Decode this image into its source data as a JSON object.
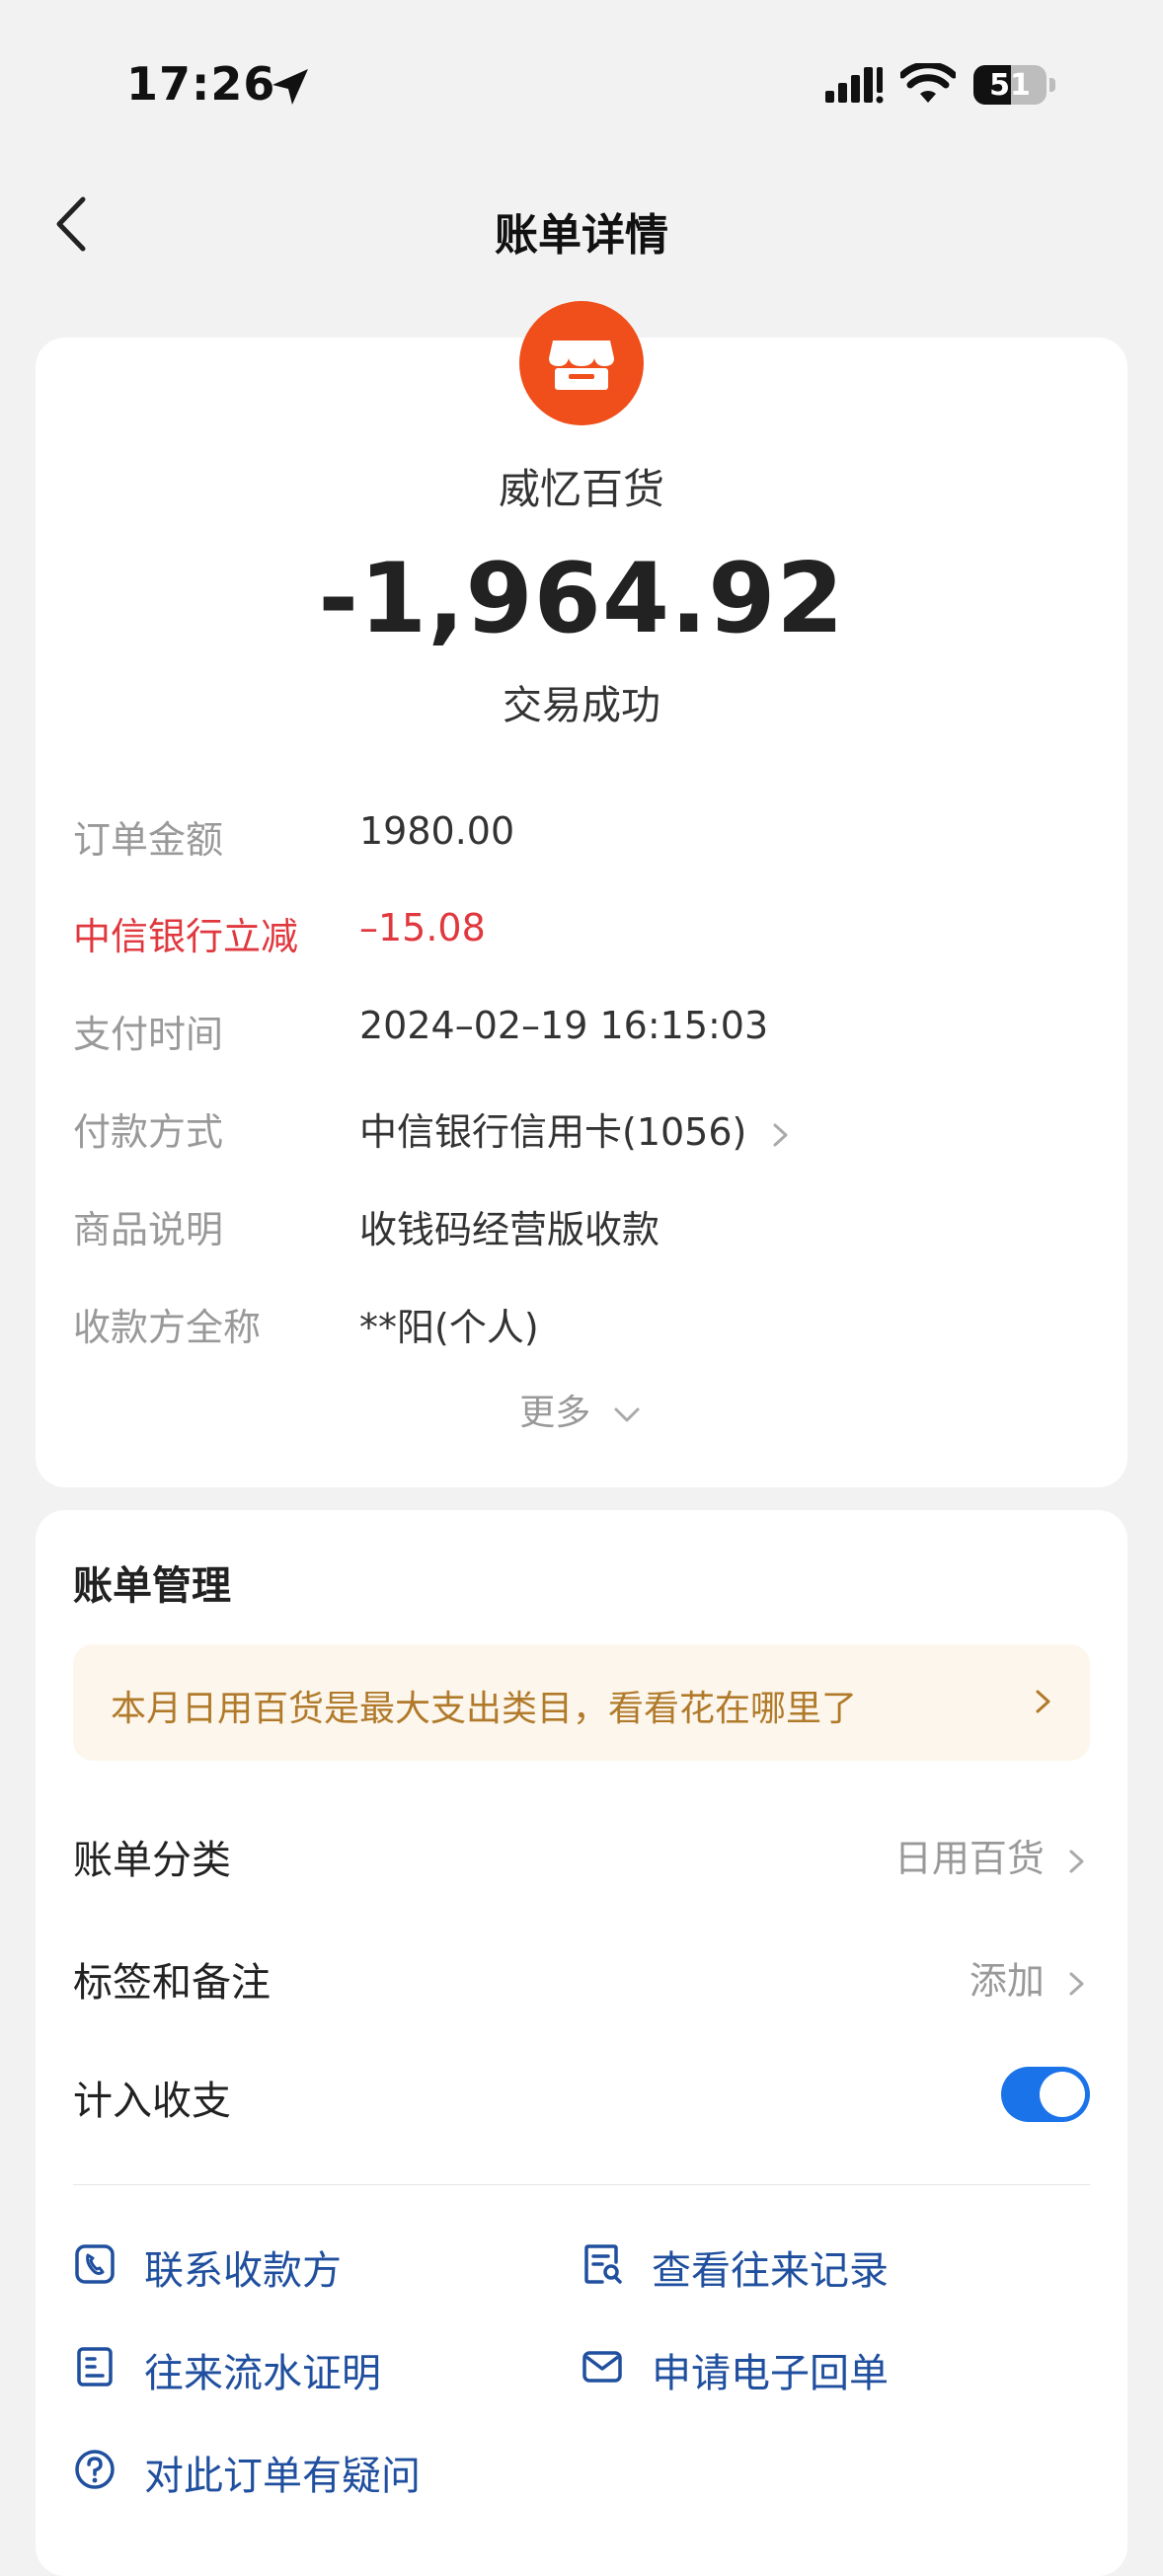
{
  "status_bar": {
    "time": "17:26",
    "battery": "51",
    "battery_level": 0.51
  },
  "nav": {
    "title": "账单详情"
  },
  "detail": {
    "merchant_name": "威忆百货",
    "amount": "-1,964.92",
    "status": "交易成功",
    "rows": [
      {
        "label": "订单金额",
        "value": "1980.00"
      },
      {
        "label": "中信银行立减",
        "value": "–15.08"
      },
      {
        "label": "支付时间",
        "value": "2024–02–19 16:15:03"
      },
      {
        "label": "付款方式",
        "value": "中信银行信用卡(1056)"
      },
      {
        "label": "商品说明",
        "value": "收钱码经营版收款"
      },
      {
        "label": "收款方全称",
        "value": "**阳(个人)"
      }
    ],
    "more": "更多"
  },
  "management": {
    "title": "账单管理",
    "tip": "本月日用百货是最大支出类目，看看花在哪里了",
    "category_label": "账单分类",
    "category_value": "日用百货",
    "tags_label": "标签和备注",
    "tags_value": "添加",
    "include_label": "计入收支",
    "include_enabled": true,
    "actions": [
      {
        "label": "联系收款方"
      },
      {
        "label": "查看往来记录"
      },
      {
        "label": "往来流水证明"
      },
      {
        "label": "申请电子回单"
      },
      {
        "label": "对此订单有疑问"
      }
    ]
  },
  "colors": {
    "accent_blue": "#1a73e8",
    "action_text": "#1f4f9e",
    "discount_red": "#e0383e",
    "merchant_orange": "#f04e1a",
    "tip_bg": "#fdf6ec",
    "tip_text": "#b07a2a"
  }
}
